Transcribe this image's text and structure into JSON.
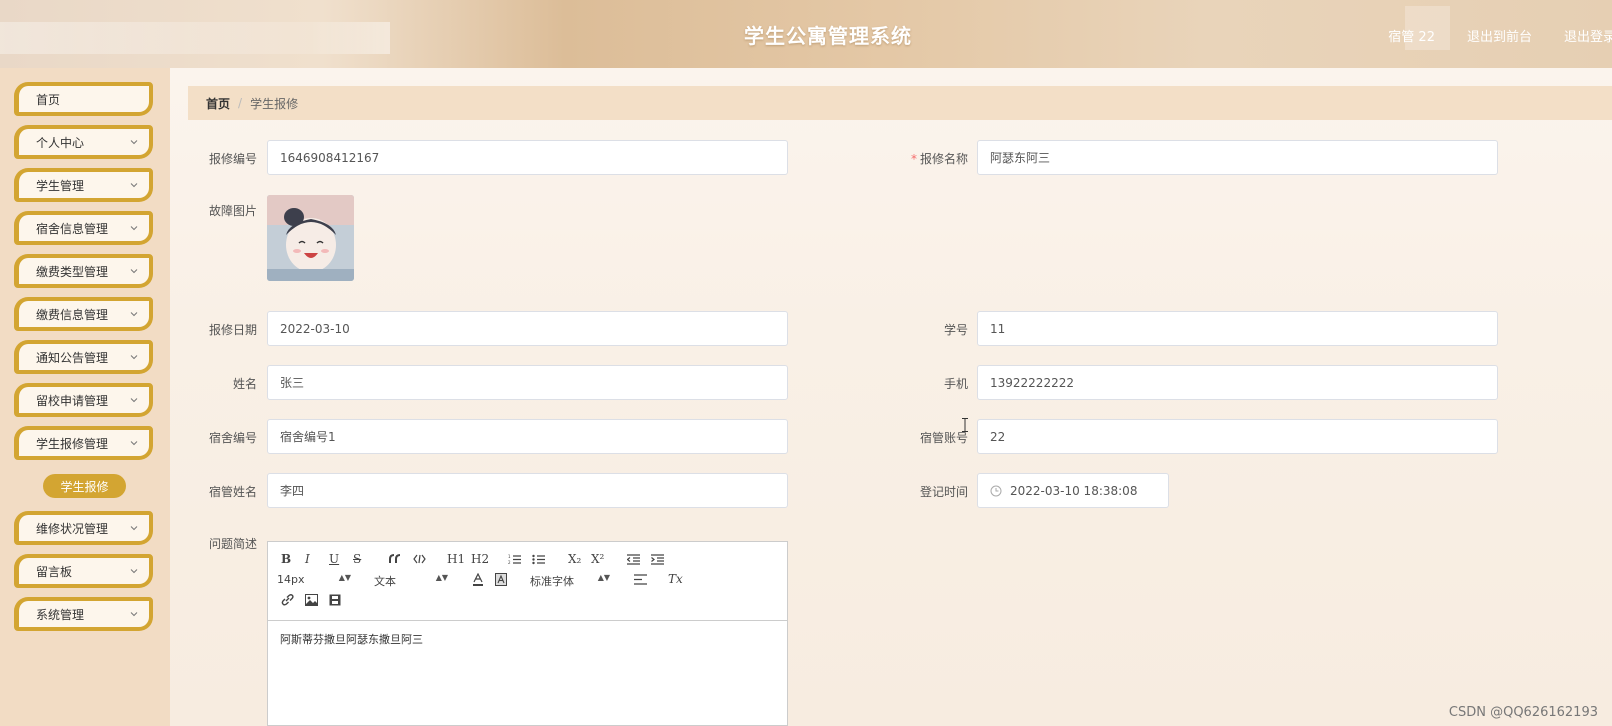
{
  "header": {
    "title": "学生公寓管理系统",
    "user": "宿管 22",
    "to_front": "退出到前台",
    "logout": "退出登录"
  },
  "sidebar": {
    "items": [
      {
        "label": "首页",
        "has_chevron": false
      },
      {
        "label": "个人中心",
        "has_chevron": true
      },
      {
        "label": "学生管理",
        "has_chevron": true
      },
      {
        "label": "宿舍信息管理",
        "has_chevron": true
      },
      {
        "label": "缴费类型管理",
        "has_chevron": true
      },
      {
        "label": "缴费信息管理",
        "has_chevron": true
      },
      {
        "label": "通知公告管理",
        "has_chevron": true
      },
      {
        "label": "留校申请管理",
        "has_chevron": true
      },
      {
        "label": "学生报修管理",
        "has_chevron": true
      },
      {
        "label": "维修状况管理",
        "has_chevron": true
      },
      {
        "label": "留言板",
        "has_chevron": true
      },
      {
        "label": "系统管理",
        "has_chevron": true
      }
    ],
    "active_sub": "学生报修"
  },
  "breadcrumb": {
    "home": "首页",
    "sep": "/",
    "current": "学生报修"
  },
  "form": {
    "repair_no": {
      "label": "报修编号",
      "value": "1646908412167"
    },
    "repair_name": {
      "label": "报修名称",
      "required": "*",
      "value": "阿瑟东阿三"
    },
    "fault_image": {
      "label": "故障图片"
    },
    "repair_date": {
      "label": "报修日期",
      "value": "2022-03-10"
    },
    "student_no": {
      "label": "学号",
      "value": "11"
    },
    "name": {
      "label": "姓名",
      "value": "张三"
    },
    "phone": {
      "label": "手机",
      "value": "13922222222"
    },
    "dorm_no": {
      "label": "宿舍编号",
      "value": "宿舍编号1"
    },
    "manager_account": {
      "label": "宿管账号",
      "value": "22"
    },
    "manager_name": {
      "label": "宿管姓名",
      "value": "李四"
    },
    "register_time": {
      "label": "登记时间",
      "value": "2022-03-10 18:38:08"
    },
    "description": {
      "label": "问题简述",
      "content": "阿斯蒂芬撒旦阿瑟东撒旦阿三",
      "toolbar": {
        "font_size": "14px",
        "text_type": "文本",
        "font_family": "标准字体",
        "bold": "B",
        "italic": "I",
        "underline": "U",
        "strike": "S",
        "h1": "H1",
        "h2": "H2",
        "sub": "X₂",
        "sup": "X²",
        "clear": "Tx"
      }
    }
  },
  "watermark": "CSDN @QQ626162193",
  "colors": {
    "accent": "#d3a532",
    "sidebar_bg": "#f2dcc4",
    "breadcrumb_bg": "#f3dfc7",
    "required": "#f56c6c"
  }
}
